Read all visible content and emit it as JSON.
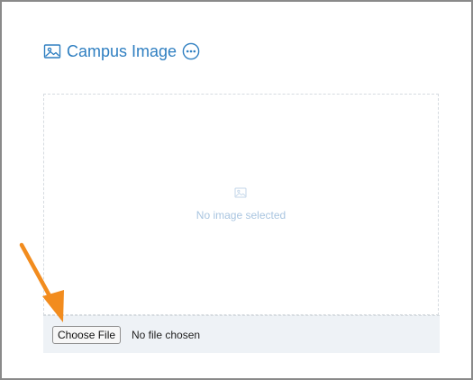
{
  "section": {
    "title": "Campus Image",
    "title_icon": "image-icon",
    "more_icon": "more-options-icon"
  },
  "preview": {
    "placeholder_icon": "image-icon",
    "placeholder_text": "No image selected"
  },
  "file_input": {
    "button_label": "Choose File",
    "status_text": "No file chosen"
  },
  "annotation": {
    "arrow_color": "#f28c1e"
  },
  "colors": {
    "accent": "#2f7fc1",
    "placeholder": "#a9c5e0",
    "file_bar_bg": "#eef2f6"
  }
}
